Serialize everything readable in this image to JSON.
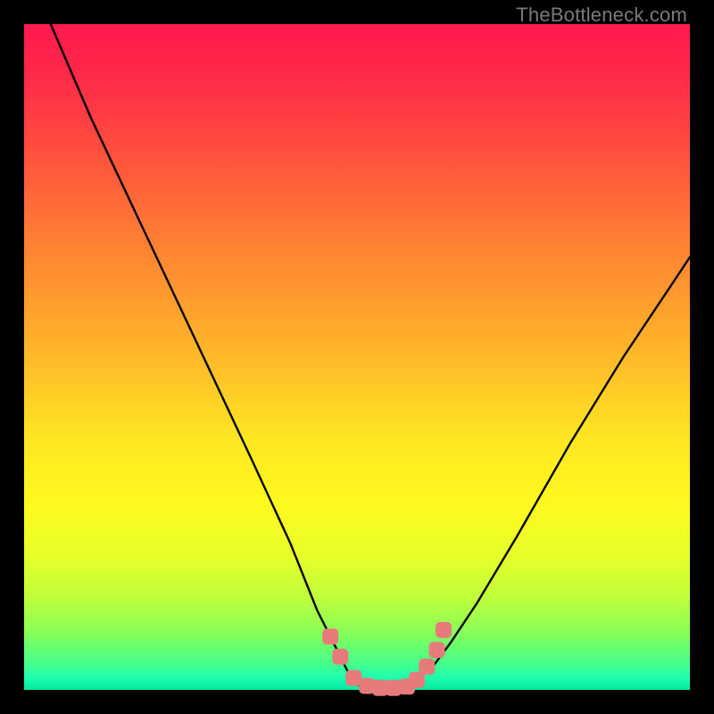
{
  "watermark": "TheBottleneck.com",
  "chart_data": {
    "type": "line",
    "title": "",
    "xlabel": "",
    "ylabel": "",
    "xlim": [
      0,
      100
    ],
    "ylim": [
      0,
      100
    ],
    "grid": false,
    "legend": false,
    "series": [
      {
        "name": "bottleneck-curve",
        "x": [
          4,
          10,
          18,
          26,
          34,
          40,
          44,
          47,
          49,
          51,
          53,
          55,
          58,
          61,
          64,
          68,
          74,
          82,
          90,
          98,
          100
        ],
        "values": [
          100,
          86,
          69,
          52,
          35,
          22,
          12,
          6,
          2,
          0,
          0,
          0,
          1,
          3,
          7,
          13,
          23,
          37,
          50,
          62,
          65
        ]
      }
    ],
    "markers": {
      "name": "highlight-dots",
      "color": "#e77b7b",
      "x": [
        46.0,
        47.5,
        49.5,
        51.5,
        53.5,
        55.5,
        57.5,
        59.0,
        60.5,
        62.0,
        63.0
      ],
      "values": [
        8.0,
        5.0,
        1.8,
        0.6,
        0.3,
        0.3,
        0.5,
        1.5,
        3.5,
        6.0,
        9.0
      ]
    }
  }
}
